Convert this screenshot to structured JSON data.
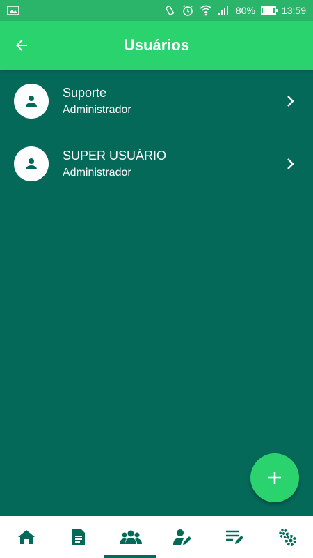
{
  "status_bar": {
    "battery_percent": "80%",
    "time": "13:59",
    "battery_level": 0.8,
    "icons": [
      "image-icon",
      "vibrate-icon",
      "alarm-icon",
      "wifi-icon",
      "signal-icon",
      "battery-icon"
    ]
  },
  "app_bar": {
    "title": "Usuários",
    "back_icon": "arrow-left-icon"
  },
  "users": [
    {
      "name": "Suporte",
      "role": "Administrador"
    },
    {
      "name": "SUPER USUÁRIO",
      "role": "Administrador"
    }
  ],
  "fab": {
    "icon": "plus-icon"
  },
  "bottom_nav": {
    "items": [
      {
        "icon": "home-icon",
        "active": false
      },
      {
        "icon": "document-icon",
        "active": false
      },
      {
        "icon": "users-icon",
        "active": true
      },
      {
        "icon": "user-edit-icon",
        "active": false
      },
      {
        "icon": "list-edit-icon",
        "active": false
      },
      {
        "icon": "settings-icon",
        "active": false
      }
    ]
  },
  "colors": {
    "background": "#05695a",
    "accent": "#2ad36e",
    "status_bar": "#2bb56b",
    "white": "#ffffff"
  }
}
